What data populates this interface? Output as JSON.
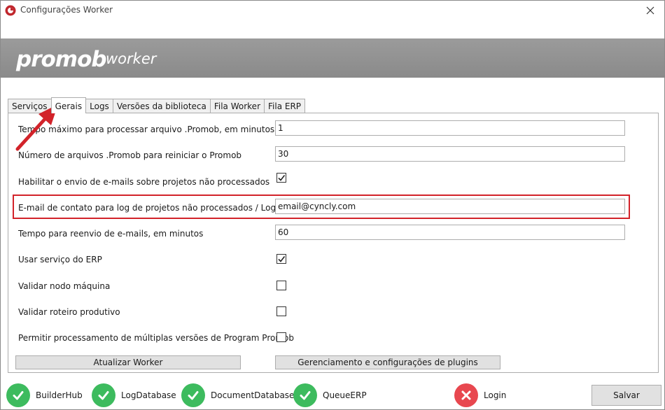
{
  "window": {
    "title": "Configurações Worker"
  },
  "banner": {
    "logo_main": "promob",
    "logo_sub": "worker"
  },
  "tabs": [
    {
      "label": "Serviços",
      "active": false
    },
    {
      "label": "Gerais",
      "active": true
    },
    {
      "label": "Logs",
      "active": false
    },
    {
      "label": "Versões da biblioteca",
      "active": false
    },
    {
      "label": "Fila Worker",
      "active": false
    },
    {
      "label": "Fila ERP",
      "active": false
    }
  ],
  "settings": {
    "max_time": {
      "label": "Tempo máximo para processar arquivo .Promob, em minutos",
      "value": "1"
    },
    "files_restart": {
      "label": "Número de arquivos .Promob para reiniciar o Promob",
      "value": "30"
    },
    "enable_email": {
      "label": "Habilitar o envio de e-mails sobre projetos não processados",
      "checked": true
    },
    "contact_email": {
      "label": "E-mail de contato para log de projetos não processados / Login",
      "value": "email@cyncly.com"
    },
    "resend_time": {
      "label": "Tempo para reenvio de e-mails, em minutos",
      "value": "60"
    },
    "use_erp": {
      "label": "Usar serviço do ERP",
      "checked": true
    },
    "validate_node": {
      "label": "Validar nodo máquina",
      "checked": false
    },
    "validate_route": {
      "label": "Validar roteiro produtivo",
      "checked": false
    },
    "multi_versions": {
      "label": "Permitir processamento de múltiplas versões de Program Promob",
      "checked": false
    }
  },
  "buttons": {
    "update_worker": "Atualizar Worker",
    "plugins": "Gerenciamento e configurações de plugins",
    "save": "Salvar"
  },
  "status": [
    {
      "label": "BuilderHub",
      "state": "ok"
    },
    {
      "label": "LogDatabase",
      "state": "ok"
    },
    {
      "label": "DocumentDatabase",
      "state": "ok"
    },
    {
      "label": "QueueERP",
      "state": "ok"
    },
    {
      "label": "Login",
      "state": "error"
    }
  ],
  "colors": {
    "ok": "#3dbb5e",
    "error": "#e8474f",
    "annotation": "#d2232a"
  }
}
